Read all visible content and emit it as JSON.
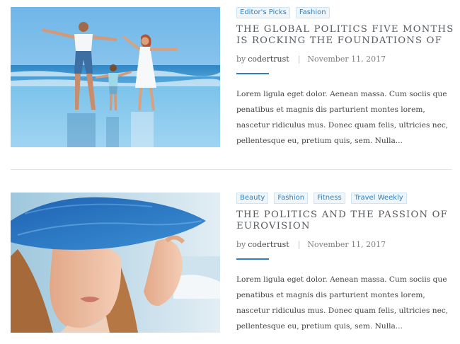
{
  "posts": [
    {
      "image_alt": "family-on-beach-photo",
      "tags": [
        "Editor's Picks",
        "Fashion"
      ],
      "title": "THE GLOBAL POLITICS FIVE MONTHS IS ROCKING THE FOUNDATIONS OF",
      "by_label": "by",
      "author": "codertrust",
      "separator": "|",
      "date": "November 11, 2017",
      "excerpt": "Lorem ligula eget dolor. Aenean massa. Cum sociis que penatibus et magnis dis parturient montes lorem, nascetur ridiculus mus. Donec quam felis, ultricies nec, pellentesque eu, pretium quis, sem. Nulla..."
    },
    {
      "image_alt": "woman-in-blue-hat-photo",
      "tags": [
        "Beauty",
        "Fashion",
        "Fitness",
        "Travel Weekly"
      ],
      "title": "THE POLITICS AND THE PASSION OF EUROVISION",
      "by_label": "by",
      "author": "codertrust",
      "separator": "|",
      "date": "November 11, 2017",
      "excerpt": "Lorem ligula eget dolor. Aenean massa. Cum sociis que penatibus et magnis dis parturient montes lorem, nascetur ridiculus mus. Donec quam felis, ultricies nec, pellentesque eu, pretium quis, sem. Nulla..."
    }
  ],
  "colors": {
    "accent": "#2f7fbf",
    "tag_bg": "#eef6fc",
    "title": "#555a5f",
    "text": "#444444",
    "divider": "#e4e4e4"
  }
}
